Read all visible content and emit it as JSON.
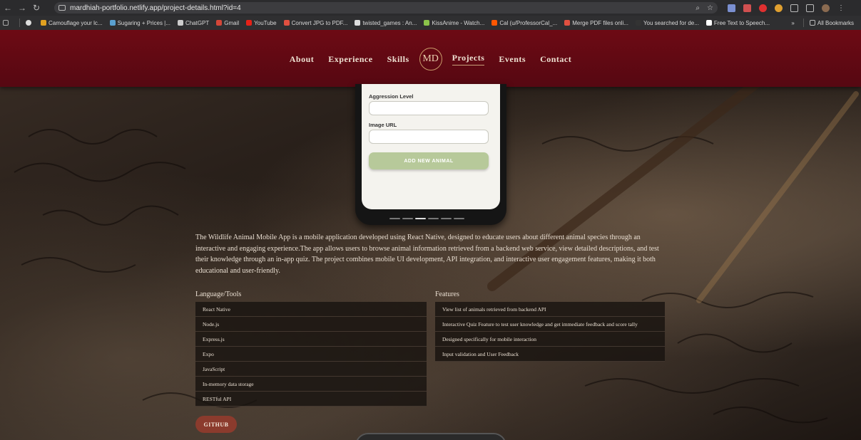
{
  "browser": {
    "url": "mardhiah-portfolio.netlify.app/project-details.html?id=4",
    "bookmarks": [
      {
        "label": "Camouflage your lc...",
        "color": "#e0a020"
      },
      {
        "label": "Sugaring + Prices |...",
        "color": "#5aa0d0"
      },
      {
        "label": "ChatGPT",
        "color": "#cccccc"
      },
      {
        "label": "Gmail",
        "color": "#d44638"
      },
      {
        "label": "YouTube",
        "color": "#e62117"
      },
      {
        "label": "Convert JPG to PDF...",
        "color": "#e05040"
      },
      {
        "label": "twisted_games : An...",
        "color": "#dddddd"
      },
      {
        "label": "KissAnime - Watch...",
        "color": "#8bc34a"
      },
      {
        "label": "Cal (u/ProfessorCal_...",
        "color": "#ff5700"
      },
      {
        "label": "Merge PDF files onli...",
        "color": "#e05040"
      },
      {
        "label": "You searched for de...",
        "color": "#333333"
      },
      {
        "label": "Free Text to Speech...",
        "color": "#ffffff"
      }
    ],
    "all_bookmarks_label": "All Bookmarks",
    "more_label": "»"
  },
  "nav": {
    "about": "About",
    "experience": "Experience",
    "skills": "Skills",
    "logo": "MD",
    "projects": "Projects",
    "events": "Events",
    "contact": "Contact"
  },
  "phone_form": {
    "aggression_label": "Aggression Level",
    "image_url_label": "Image URL",
    "add_button": "ADD NEW ANIMAL"
  },
  "description": "The Wildlife Animal Mobile App is a mobile application developed using React Native, designed to educate users about different animal species through an interactive and engaging experience.The app allows users to browse animal information retrieved from a backend web service, view detailed descriptions, and test their knowledge through an in-app quiz. The project combines mobile UI development, API integration, and interactive user engagement features, making it both educational and user-friendly.",
  "tools": {
    "title": "Language/Tools",
    "items": [
      "React Native",
      "Node.js",
      "Express.js",
      "Expo",
      "JavaScript",
      "In-memory data storage",
      "RESTful API"
    ]
  },
  "features": {
    "title": "Features",
    "items": [
      "View list of animals retrieved from backend API",
      "Interactive Quiz Feature to test user knowledge and get immediate feedback and score tally",
      "Designed specifically for mobile interaction",
      "Input validation and User Feedback"
    ]
  },
  "github_label": "GITHUB"
}
